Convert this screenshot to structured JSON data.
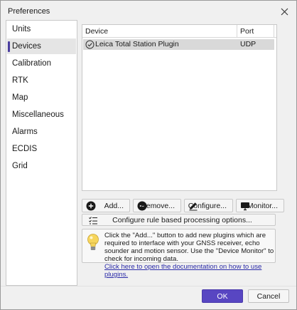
{
  "window": {
    "title": "Preferences"
  },
  "sidebar": {
    "items": [
      {
        "label": "Units"
      },
      {
        "label": "Devices",
        "active": true
      },
      {
        "label": "Calibration"
      },
      {
        "label": "RTK"
      },
      {
        "label": "Map"
      },
      {
        "label": "Miscellaneous"
      },
      {
        "label": "Alarms"
      },
      {
        "label": "ECDIS"
      },
      {
        "label": "Grid"
      }
    ]
  },
  "device_list": {
    "columns": [
      "Device",
      "Port"
    ],
    "rows": [
      {
        "device": "Leica Total Station Plugin",
        "port": "UDP",
        "status_icon": "check-circle-icon"
      }
    ]
  },
  "toolbar": {
    "add_label": "Add...",
    "remove_label": "Remove...",
    "configure_label": "Configure...",
    "monitor_label": "Monitor...",
    "rule_label": "Configure rule based processing options..."
  },
  "info": {
    "text": "Click the \"Add...\" button to add new plugins which are required to interface with your GNSS receiver, echo sounder and motion sensor. Use the \"Device Monitor\" to check for incoming data.",
    "link": "Click here to open the documentation on how to use plugins."
  },
  "footer": {
    "ok_label": "OK",
    "cancel_label": "Cancel"
  },
  "colors": {
    "accent": "#5846c2",
    "selection": "#d9d9d9",
    "link": "#2a2aa8"
  }
}
